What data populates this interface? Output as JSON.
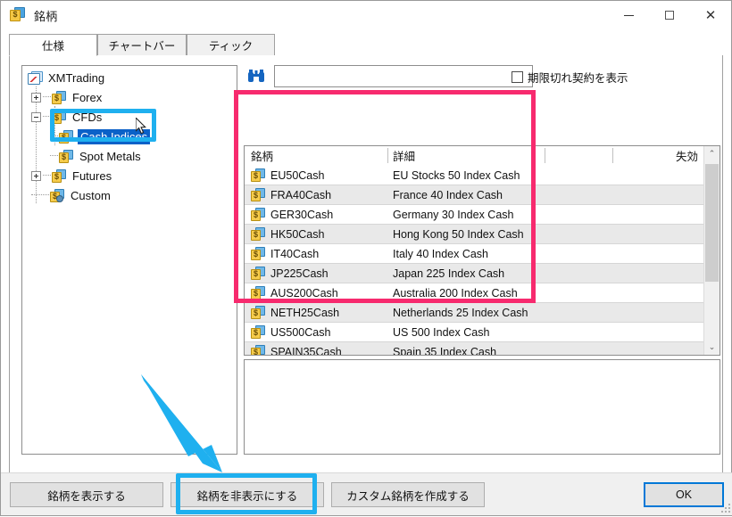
{
  "window": {
    "title": "銘柄",
    "icon": "symbols-window-icon",
    "minimize": "−",
    "maximize": "□",
    "close": "✕"
  },
  "tabs": [
    {
      "label": "仕様",
      "active": true
    },
    {
      "label": "チャートバー",
      "active": false
    },
    {
      "label": "ティック",
      "active": false
    }
  ],
  "tree": {
    "root": {
      "label": "XMTrading",
      "icon": "xmtrading-root-icon"
    },
    "items": [
      {
        "label": "Forex",
        "icon": "folder-dollar-icon",
        "expander": "plus",
        "indent": 1,
        "selected": false
      },
      {
        "label": "CFDs",
        "icon": "folder-dollar-icon",
        "expander": "minus",
        "indent": 1,
        "selected": false
      },
      {
        "label": "Cash Indices",
        "icon": "folder-dollar-icon",
        "expander": "none",
        "indent": 2,
        "selected": true
      },
      {
        "label": "Spot Metals",
        "icon": "folder-dollar-icon",
        "expander": "none",
        "indent": 2,
        "selected": false
      },
      {
        "label": "Futures",
        "icon": "folder-dollar-icon",
        "expander": "plus",
        "indent": 1,
        "selected": false
      },
      {
        "label": "Custom",
        "icon": "folder-gear-icon",
        "expander": "none",
        "indent": 1,
        "selected": false
      }
    ]
  },
  "search": {
    "icon": "binoculars-icon",
    "value": "",
    "placeholder": ""
  },
  "expired_checkbox": {
    "label": "期限切れ契約を表示",
    "checked": false
  },
  "grid": {
    "columns": [
      "銘柄",
      "詳細",
      "",
      "失効"
    ],
    "rows": [
      {
        "symbol": "EU50Cash",
        "description": "EU Stocks 50 Index Cash",
        "col3": "",
        "expiry": ""
      },
      {
        "symbol": "FRA40Cash",
        "description": "France 40 Index Cash",
        "col3": "",
        "expiry": ""
      },
      {
        "symbol": "GER30Cash",
        "description": "Germany 30 Index Cash",
        "col3": "",
        "expiry": ""
      },
      {
        "symbol": "HK50Cash",
        "description": "Hong Kong 50 Index Cash",
        "col3": "",
        "expiry": ""
      },
      {
        "symbol": "IT40Cash",
        "description": "Italy 40 Index Cash",
        "col3": "",
        "expiry": ""
      },
      {
        "symbol": "JP225Cash",
        "description": "Japan 225 Index Cash",
        "col3": "",
        "expiry": ""
      },
      {
        "symbol": "AUS200Cash",
        "description": "Australia 200 Index Cash",
        "col3": "",
        "expiry": ""
      },
      {
        "symbol": "NETH25Cash",
        "description": "Netherlands 25 Index Cash",
        "col3": "",
        "expiry": ""
      },
      {
        "symbol": "US500Cash",
        "description": "US 500 Index Cash",
        "col3": "",
        "expiry": ""
      },
      {
        "symbol": "SPAIN35Cash",
        "description": "Spain 35 Index Cash",
        "col3": "",
        "expiry": ""
      }
    ],
    "scrollbar": {
      "up": "⌃",
      "down": "⌄"
    }
  },
  "buttons": {
    "show": "銘柄を表示する",
    "hide": "銘柄を非表示にする",
    "custom": "カスタム銘柄を作成する",
    "ok": "OK"
  },
  "annotations": {
    "highlight_color": "#1fb0ef",
    "box_color": "#f72a6e",
    "arrow_color": "#1fb0ef",
    "selection_color": "#0b61c8"
  }
}
